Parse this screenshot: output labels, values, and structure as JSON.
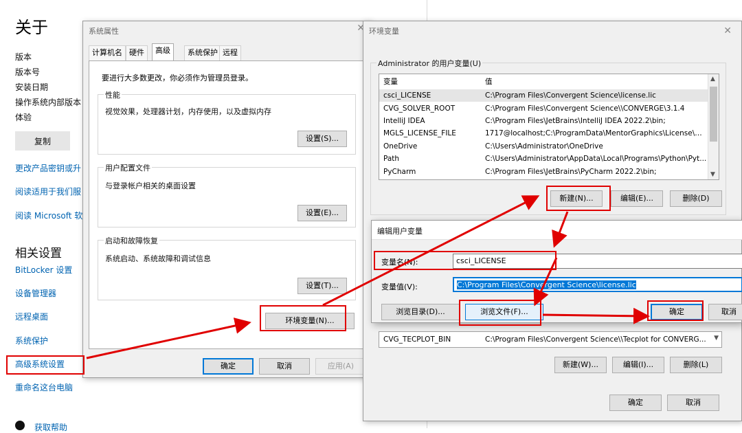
{
  "settings": {
    "title": "关于",
    "specs": [
      "版本",
      "版本号",
      "安装日期",
      "操作系统内部版本",
      "体验"
    ],
    "copy_label": "复制",
    "links": [
      "更改产品密钥或升",
      "阅读适用于我们服",
      "阅读 Microsoft 软"
    ],
    "related_title": "相关设置",
    "related_links": [
      "BitLocker 设置",
      "设备管理器",
      "远程桌面",
      "系统保护",
      "高级系统设置",
      "重命名这台电脑"
    ],
    "help_label": "获取帮助"
  },
  "system_properties": {
    "title": "系统属性",
    "tabs": [
      "计算机名",
      "硬件",
      "高级",
      "系统保护",
      "远程"
    ],
    "admin_note": "要进行大多数更改，你必须作为管理员登录。",
    "groups": [
      {
        "label": "性能",
        "desc": "视觉效果，处理器计划，内存使用，以及虚拟内存",
        "button": "设置(S)..."
      },
      {
        "label": "用户配置文件",
        "desc": "与登录帐户相关的桌面设置",
        "button": "设置(E)..."
      },
      {
        "label": "启动和故障恢复",
        "desc": "系统启动、系统故障和调试信息",
        "button": "设置(T)..."
      }
    ],
    "env_button": "环境变量(N)...",
    "ok": "确定",
    "cancel": "取消",
    "apply": "应用(A)"
  },
  "env_vars": {
    "title": "环境变量",
    "user_group_label": "Administrator 的用户变量(U)",
    "headers": [
      "变量",
      "值"
    ],
    "rows": [
      {
        "name": "csci_LICENSE",
        "value": "C:\\Program Files\\Convergent Science\\license.lic"
      },
      {
        "name": "CVG_SOLVER_ROOT",
        "value": "C:\\Program Files\\Convergent Science\\\\CONVERGE\\3.1.4"
      },
      {
        "name": "IntelliJ IDEA",
        "value": "C:\\Program Files\\JetBrains\\IntelliJ IDEA 2022.2\\bin;"
      },
      {
        "name": "MGLS_LICENSE_FILE",
        "value": "1717@localhost;C:\\ProgramData\\MentorGraphics\\License\\m..."
      },
      {
        "name": "OneDrive",
        "value": "C:\\Users\\Administrator\\OneDrive"
      },
      {
        "name": "Path",
        "value": "C:\\Users\\Administrator\\AppData\\Local\\Programs\\Python\\Pyt..."
      },
      {
        "name": "PyCharm",
        "value": "C:\\Program Files\\JetBrains\\PyCharm 2022.2\\bin;"
      }
    ],
    "user_buttons": [
      "新建(N)...",
      "编辑(E)...",
      "删除(D)"
    ],
    "system_row": {
      "name": "CVG_TECPLOT_BIN",
      "value": "C:\\Program Files\\Convergent Science\\\\Tecplot for CONVERG..."
    },
    "system_buttons": [
      "新建(W)...",
      "编辑(I)...",
      "删除(L)"
    ],
    "ok": "确定",
    "cancel": "取消"
  },
  "edit_dialog": {
    "title": "编辑用户变量",
    "name_label": "变量名(N):",
    "name_value": "csci_LICENSE",
    "value_label": "变量值(V):",
    "value_value": "C:\\Program Files\\Convergent Science\\license.lic",
    "browse_dir": "浏览目录(D)...",
    "browse_file": "浏览文件(F)...",
    "ok": "确定",
    "cancel": "取消"
  },
  "colors": {
    "accent": "#0078d7",
    "annotation": "#e00000",
    "link": "#0063b1"
  }
}
